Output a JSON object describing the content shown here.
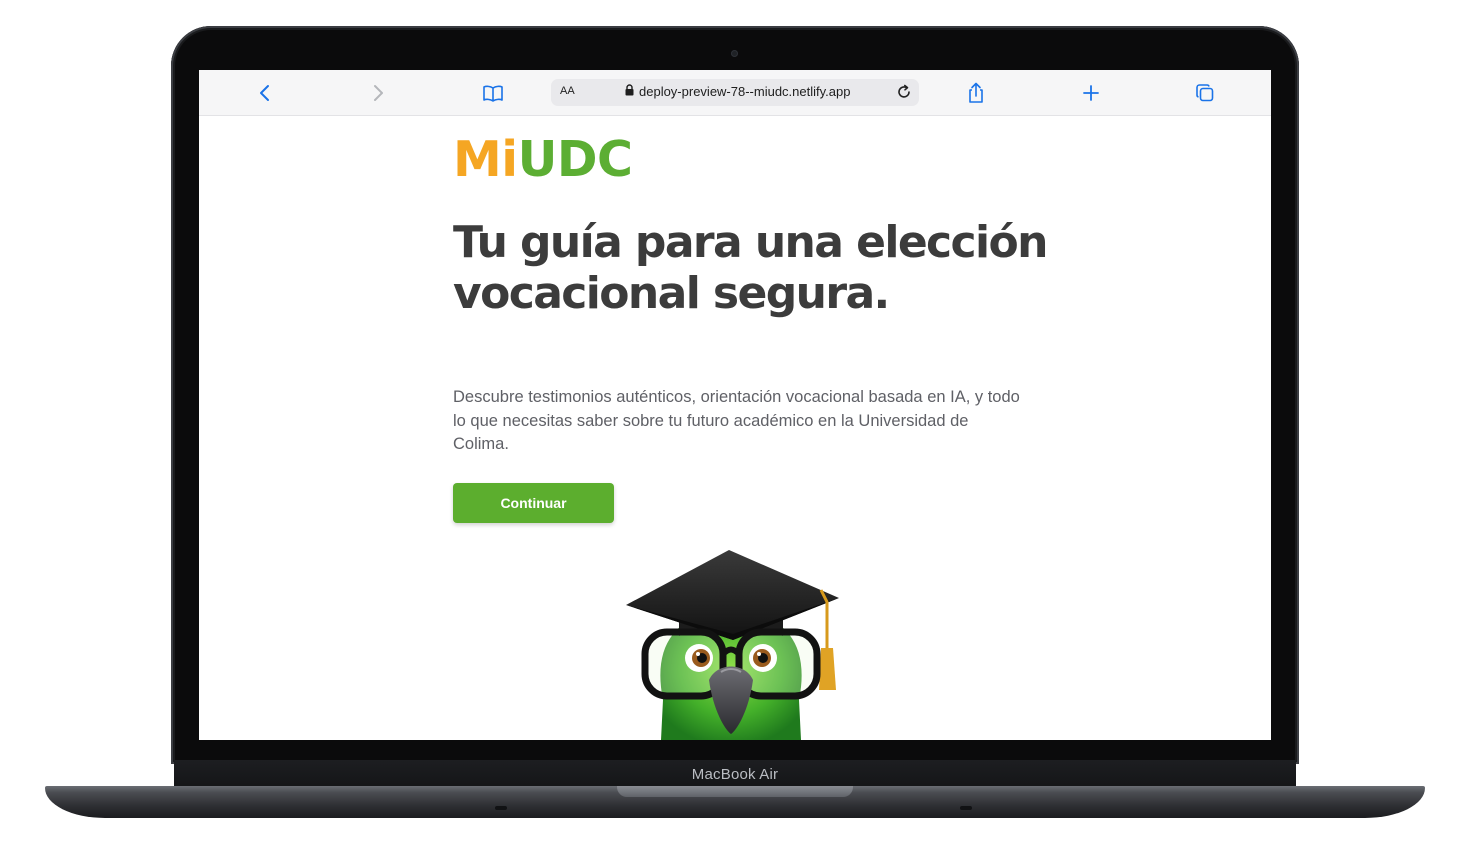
{
  "device": {
    "model_label": "MacBook Air"
  },
  "browser": {
    "text_size_label": "AA",
    "url": "deploy-preview-78--miudc.netlify.app",
    "icons": [
      "back-icon",
      "forward-icon",
      "bookmarks-icon",
      "lock-icon",
      "reload-icon",
      "share-icon",
      "new-tab-icon",
      "tabs-icon"
    ]
  },
  "page": {
    "logo": {
      "mi": "Mi",
      "udc": "UDC"
    },
    "headline": "Tu guía para una elección vocacional segura.",
    "subtitle": "Descubre testimonios auténticos, orientación vocacional basada en IA, y todo lo que necesitas saber sobre tu futuro académico en la Universidad de Colima.",
    "cta_label": "Continuar"
  },
  "colors": {
    "logo_orange": "#f5a623",
    "logo_green": "#5cae33",
    "button_green": "#5cae2e",
    "headline": "#3c3c3c",
    "link_blue": "#1a73e8"
  }
}
